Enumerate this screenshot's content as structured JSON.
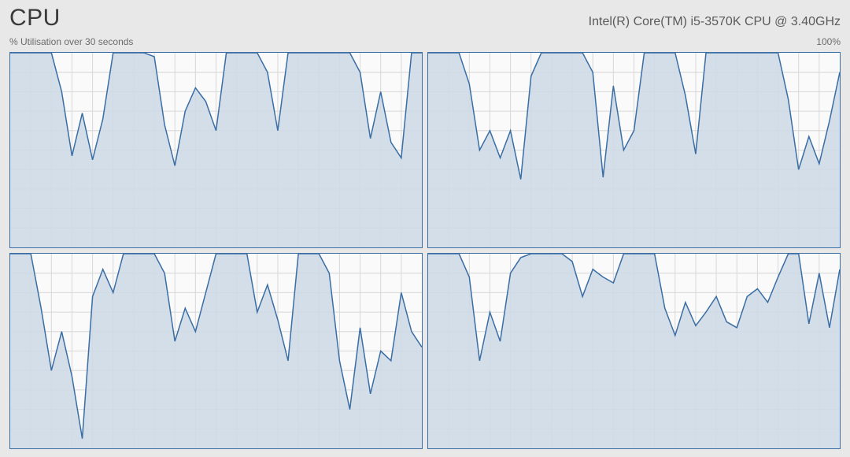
{
  "header": {
    "title": "CPU",
    "model": "Intel(R) Core(TM) i5-3570K CPU @ 3.40GHz"
  },
  "subheader": {
    "left": "% Utilisation over 30 seconds",
    "right": "100%"
  },
  "chart_data": [
    {
      "type": "area",
      "ylim": [
        0,
        100
      ],
      "xlim": [
        0,
        30
      ],
      "values": [
        100,
        100,
        100,
        100,
        100,
        80,
        47,
        69,
        45,
        66,
        100,
        100,
        100,
        100,
        98,
        63,
        42,
        70,
        82,
        75,
        60,
        100,
        100,
        100,
        100,
        90,
        60,
        100,
        100,
        100,
        100,
        100,
        100,
        100,
        90,
        56,
        80,
        54,
        46,
        100,
        100
      ]
    },
    {
      "type": "area",
      "ylim": [
        0,
        100
      ],
      "xlim": [
        0,
        30
      ],
      "values": [
        100,
        100,
        100,
        100,
        84,
        50,
        60,
        46,
        60,
        35,
        88,
        100,
        100,
        100,
        100,
        100,
        90,
        36,
        83,
        50,
        60,
        100,
        100,
        100,
        100,
        78,
        48,
        100,
        100,
        100,
        100,
        100,
        100,
        100,
        100,
        76,
        40,
        57,
        43,
        65,
        90
      ]
    },
    {
      "type": "area",
      "ylim": [
        0,
        100
      ],
      "xlim": [
        0,
        30
      ],
      "values": [
        100,
        100,
        100,
        72,
        40,
        60,
        37,
        5,
        78,
        92,
        80,
        100,
        100,
        100,
        100,
        90,
        55,
        72,
        60,
        80,
        100,
        100,
        100,
        100,
        70,
        84,
        66,
        45,
        100,
        100,
        100,
        90,
        45,
        20,
        62,
        28,
        50,
        45,
        80,
        60,
        52
      ]
    },
    {
      "type": "area",
      "ylim": [
        0,
        100
      ],
      "xlim": [
        0,
        30
      ],
      "values": [
        100,
        100,
        100,
        100,
        88,
        45,
        70,
        55,
        90,
        98,
        100,
        100,
        100,
        100,
        96,
        78,
        92,
        88,
        85,
        100,
        100,
        100,
        100,
        72,
        58,
        75,
        63,
        70,
        78,
        65,
        62,
        78,
        82,
        75,
        88,
        100,
        100,
        64,
        90,
        62,
        92
      ]
    }
  ],
  "chart_style": {
    "line_color": "#3a6ea5",
    "fill_color": "#cfdae6",
    "grid_color": "#d8d8d8",
    "grid_divisions_x": 20,
    "grid_divisions_y": 10
  }
}
